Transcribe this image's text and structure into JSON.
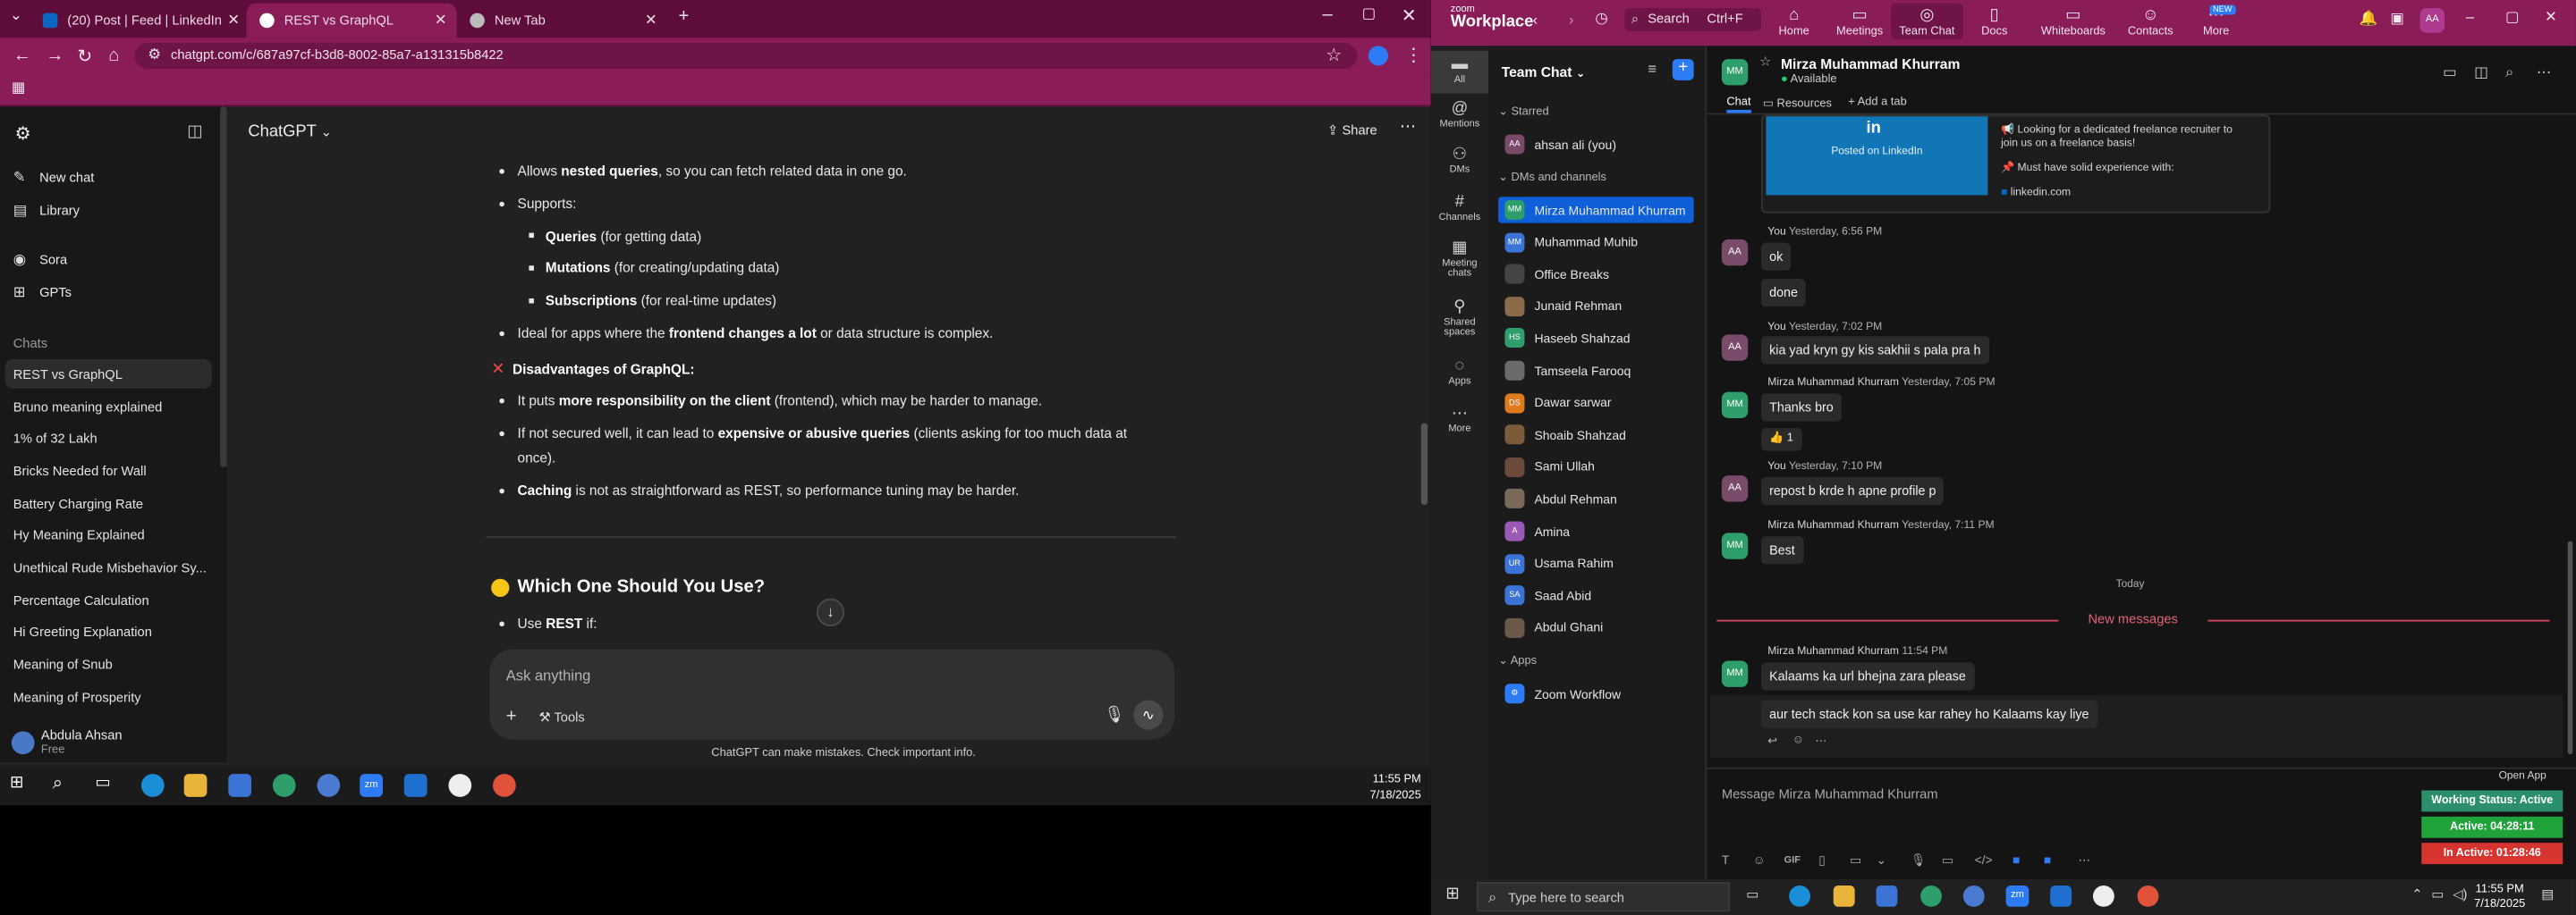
{
  "chrome": {
    "tabs": [
      {
        "title": "(20) Post | Feed | LinkedIn",
        "icon": "linkedin-icon",
        "color": "#0a66c2"
      },
      {
        "title": "REST vs GraphQL",
        "icon": "chatgpt-icon",
        "color": "#ffffff"
      },
      {
        "title": "New Tab",
        "icon": "globe-icon",
        "color": "#bbbbbb"
      }
    ],
    "url": "chatgpt.com/c/687a97cf-b3d8-8002-85a7-a131315b8422"
  },
  "gpt": {
    "sidebar": {
      "new_chat": "New chat",
      "library": "Library",
      "sora": "Sora",
      "gpts": "GPTs",
      "chats_label": "Chats",
      "chats": [
        "REST vs GraphQL",
        "Bruno meaning explained",
        "1% of 32 Lakh",
        "Bricks Needed for Wall",
        "Battery Charging Rate",
        "Hy Meaning Explained",
        "Unethical Rude Misbehavior Sy...",
        "Percentage Calculation",
        "Hi Greeting Explanation",
        "Meaning of Snub",
        "Meaning of Prosperity"
      ],
      "user_name": "Abdula Ahsan",
      "user_plan": "Free"
    },
    "header_title": "ChatGPT",
    "share": "Share",
    "content": {
      "l1_a": "Allows ",
      "l1_b": "nested queries",
      "l1_c": ", so you can fetch related data in one go.",
      "l2": "Supports:",
      "q_b": "Queries",
      "q_c": " (for getting data)",
      "m_b": "Mutations",
      "m_c": " (for creating/updating data)",
      "s_b": "Subscriptions",
      "s_c": " (for real-time updates)",
      "l3_a": "Ideal for apps where the ",
      "l3_b": "frontend changes a lot",
      "l3_c": " or data structure is complex.",
      "disadv_heading": "Disadvantages of GraphQL:",
      "d1_a": "It puts ",
      "d1_b": "more responsibility on the client",
      "d1_c": " (frontend), which may be harder to manage.",
      "d2_a": "If not secured well, it can lead to ",
      "d2_b": "expensive or abusive queries",
      "d2_c": " (clients asking for too much data at",
      "d2_d": "once).",
      "d3_b": "Caching",
      "d3_c": " is not as straightforward as REST, so performance tuning may be harder.",
      "which_heading": "Which One Should You Use?",
      "use_a": "Use ",
      "use_b": "REST",
      "use_c": " if:"
    },
    "composer_placeholder": "Ask anything",
    "tools": "Tools",
    "disclaimer": "ChatGPT can make mistakes. Check important info."
  },
  "left_clock": {
    "time": "11:55 PM",
    "date": "7/18/2025"
  },
  "zoom": {
    "logo_top": "zoom",
    "logo_bottom": "Workplace",
    "search": "Search",
    "search_shortcut": "Ctrl+F",
    "nav": [
      "Home",
      "Meetings",
      "Team Chat",
      "Docs",
      "Whiteboards",
      "Contacts",
      "More"
    ],
    "new_badge": "NEW",
    "avatar": "AA",
    "rail": [
      "All",
      "Mentions",
      "DMs",
      "Channels",
      "Meeting chats",
      "Shared spaces",
      "Apps",
      "More"
    ],
    "list_title": "Team Chat",
    "starred": "Starred",
    "starred_contact": "ahsan ali (you)",
    "dms_label": "DMs and channels",
    "contacts": [
      {
        "name": "Mirza Muhammad Khurram",
        "initials": "MM",
        "color": "#2e9e6b"
      },
      {
        "name": "Muhammad Muhib",
        "initials": "MM",
        "color": "#3b74d6"
      },
      {
        "name": "Office Breaks",
        "initials": "",
        "color": "#444444"
      },
      {
        "name": "Junaid Rehman",
        "initials": "",
        "color": "#8a6b4a"
      },
      {
        "name": "Haseeb Shahzad",
        "initials": "HS",
        "color": "#2e9e6b"
      },
      {
        "name": "Tamseela Farooq",
        "initials": "",
        "color": "#6b6b6b"
      },
      {
        "name": "Dawar sarwar",
        "initials": "DS",
        "color": "#e07a1f"
      },
      {
        "name": "Shoaib Shahzad",
        "initials": "",
        "color": "#7a5b3a"
      },
      {
        "name": "Sami Ullah",
        "initials": "",
        "color": "#6a4a3a"
      },
      {
        "name": "Abdul Rehman",
        "initials": "",
        "color": "#7a6a5a"
      },
      {
        "name": "Amina",
        "initials": "A",
        "color": "#9b59b6"
      },
      {
        "name": "Usama Rahim",
        "initials": "UR",
        "color": "#3b74d6"
      },
      {
        "name": "Saad Abid",
        "initials": "SA",
        "color": "#3b74d6"
      },
      {
        "name": "Abdul Ghani",
        "initials": "",
        "color": "#6a5a4a"
      }
    ],
    "apps_label": "Apps",
    "app_item": "Zoom Workflow",
    "chat": {
      "name": "Mirza Muhammad Khurram",
      "initials": "MM",
      "status": "Available",
      "tabs": [
        "Chat",
        "Resources",
        "Add a tab"
      ],
      "li_card": {
        "img_text": "Posted on LinkedIn",
        "line1": "📢 Looking for a dedicated freelance recruiter to",
        "line2": "join us on a freelance basis!",
        "line3": "📌 Must have solid experience with:",
        "link": "linkedin.com"
      },
      "messages": [
        {
          "meta_name": "You",
          "meta_time": "Yesterday, 6:56 PM",
          "lines": [
            "ok",
            "done"
          ]
        },
        {
          "meta_name": "You",
          "meta_time": "Yesterday, 7:02 PM",
          "lines": [
            "kia yad kryn gy kis sakhii s pala pra h"
          ]
        },
        {
          "meta_name": "Mirza Muhammad Khurram",
          "meta_time": "Yesterday, 7:05 PM",
          "lines": [
            "Thanks bro"
          ],
          "reaction": "👍 1"
        },
        {
          "meta_name": "You",
          "meta_time": "Yesterday, 7:10 PM",
          "lines": [
            "repost b krde h apne profile p"
          ]
        },
        {
          "meta_name": "Mirza Muhammad Khurram",
          "meta_time": "Yesterday, 7:11 PM",
          "lines": [
            "Best"
          ]
        },
        {
          "meta_name": "Mirza Muhammad Khurram",
          "meta_time": "11:54 PM",
          "lines": [
            "Kalaams ka url bhejna zara please",
            "aur tech stack kon sa use kar rahey ho Kalaams kay liye"
          ]
        }
      ],
      "today": "Today",
      "new_messages": "New messages",
      "compose_placeholder": "Message Mirza Muhammad Khurram",
      "open_app": "Open App",
      "working_status": "Working Status: Active",
      "active_time": "Active: 04:28:11",
      "inactive_time": "In Active: 01:28:46",
      "gif": "GIF"
    }
  },
  "taskbar": {
    "search_placeholder": "Type here to search",
    "time": "11:55 PM",
    "date": "7/18/2025"
  }
}
